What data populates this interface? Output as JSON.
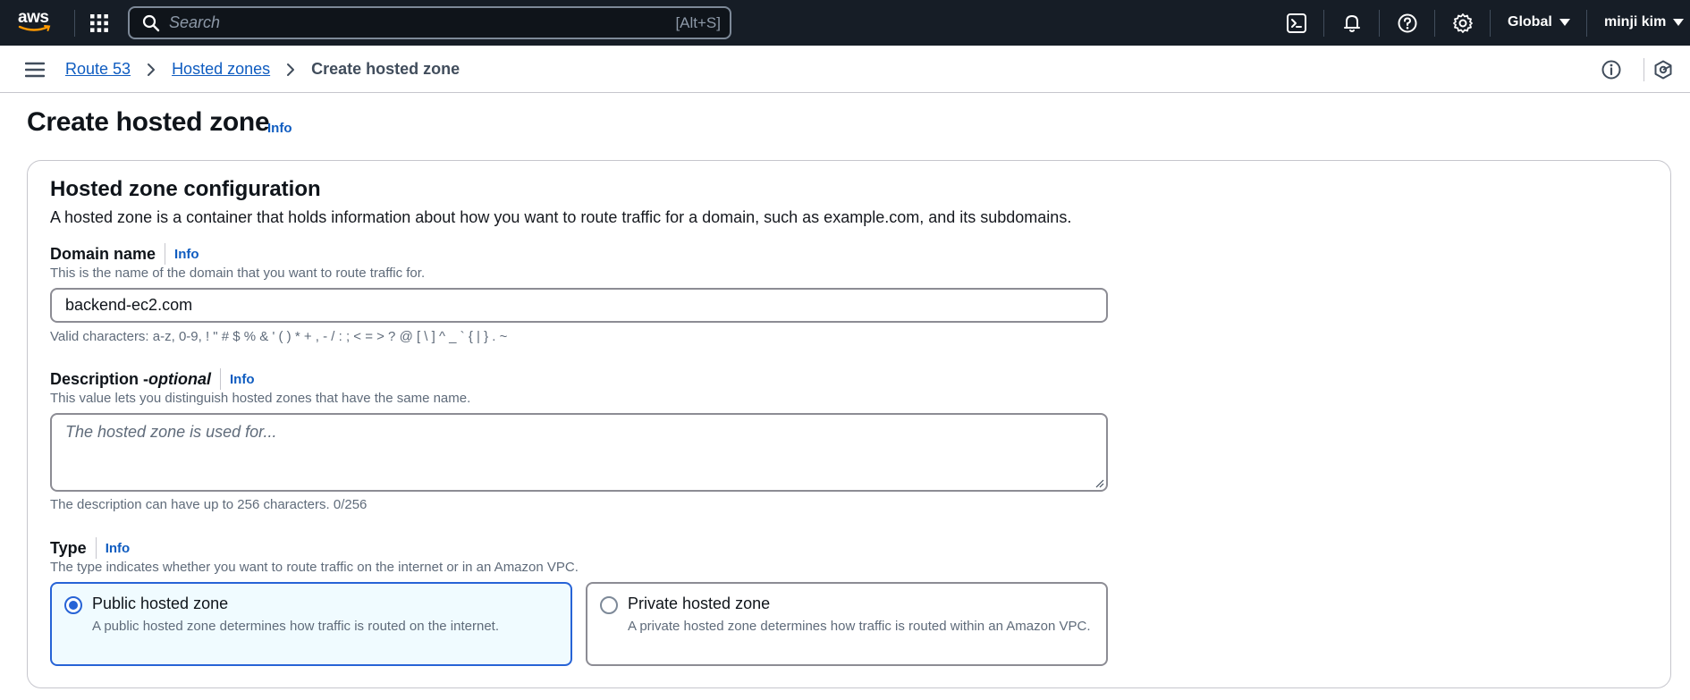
{
  "topnav": {
    "logo_text": "aws",
    "search_placeholder": "Search",
    "search_shortcut": "[Alt+S]",
    "region": "Global",
    "user": "minji kim",
    "icons": [
      "grid-icon",
      "search-icon",
      "cloudshell-icon",
      "bell-icon",
      "help-icon",
      "gear-icon"
    ]
  },
  "breadcrumb": {
    "items": [
      "Route 53",
      "Hosted zones"
    ],
    "current": "Create hosted zone"
  },
  "page": {
    "title": "Create hosted zone",
    "info": "Info"
  },
  "section": {
    "title": "Hosted zone configuration",
    "description": "A hosted zone is a container that holds information about how you want to route traffic for a domain, such as example.com, and its subdomains."
  },
  "domain": {
    "label": "Domain name",
    "info": "Info",
    "hint": "This is the name of the domain that you want to route traffic for.",
    "value": "backend-ec2.com",
    "constraint": "Valid characters: a-z, 0-9, ! \" # $ % & ' ( ) * + , - / : ; < = > ? @ [ \\ ] ^ _ ` { | } . ~"
  },
  "description_field": {
    "label": "Description - ",
    "label_optional": "optional",
    "info": "Info",
    "hint": "This value lets you distinguish hosted zones that have the same name.",
    "placeholder": "The hosted zone is used for...",
    "constraint": "The description can have up to 256 characters. 0/256"
  },
  "type": {
    "label": "Type",
    "info": "Info",
    "hint": "The type indicates whether you want to route traffic on the internet or in an Amazon VPC.",
    "options": [
      {
        "title": "Public hosted zone",
        "desc": "A public hosted zone determines how traffic is routed on the internet.",
        "selected": true
      },
      {
        "title": "Private hosted zone",
        "desc": "A private hosted zone determines how traffic is routed within an Amazon VPC.",
        "selected": false
      }
    ]
  },
  "colors": {
    "nav_bg": "#161d26",
    "link": "#0f5cc0",
    "selected": "#2763d6",
    "selected_bg": "#f0fbff"
  }
}
